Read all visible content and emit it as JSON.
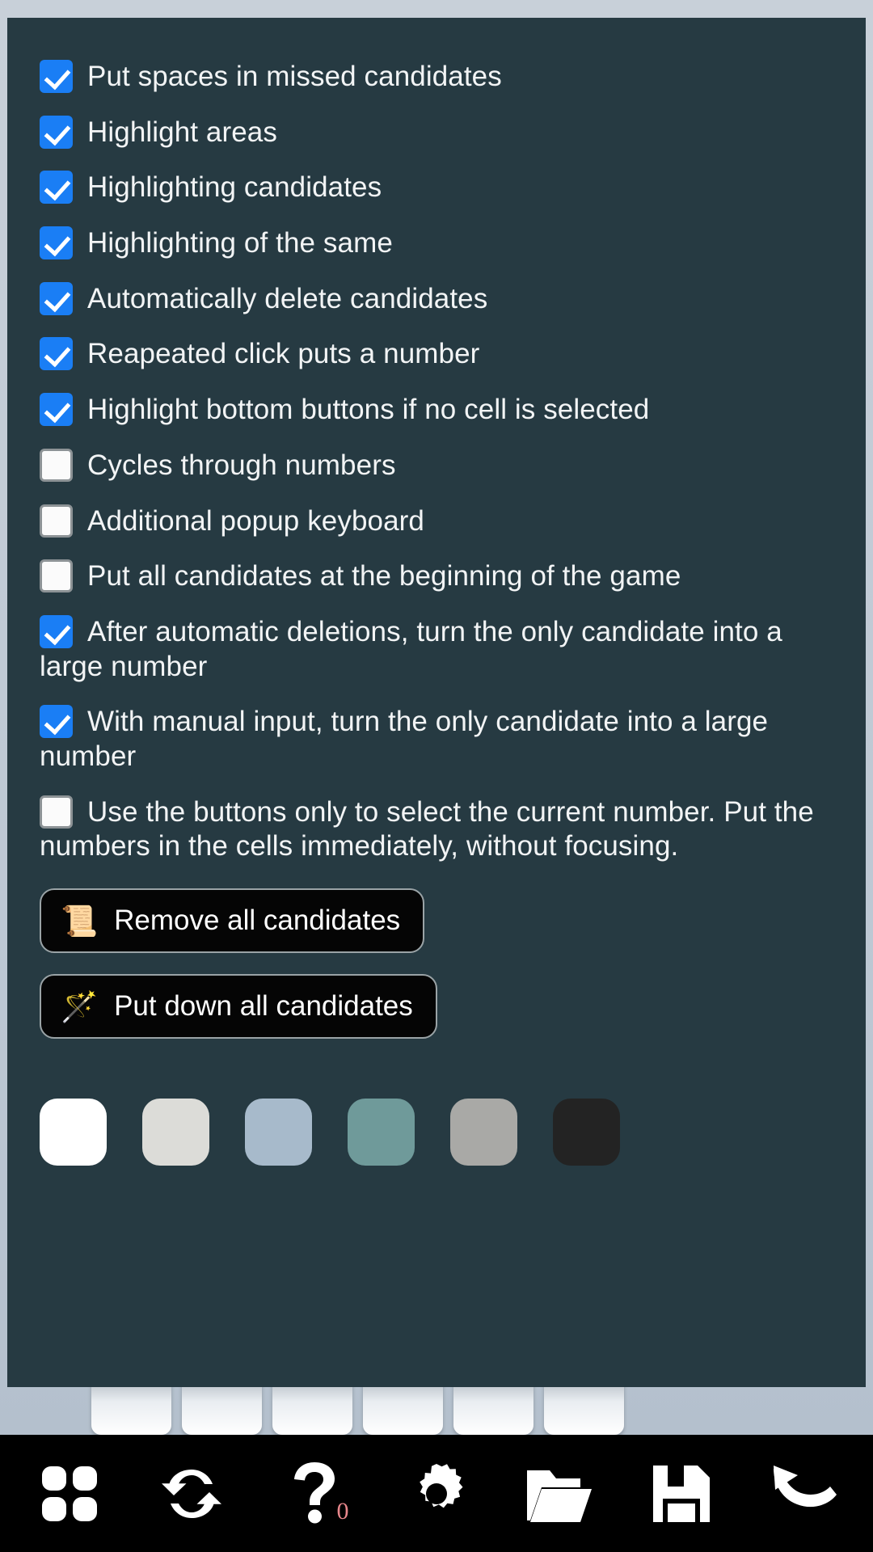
{
  "panel": {
    "background_color": "#263a42",
    "options": [
      {
        "label": "Put spaces in missed candidates",
        "checked": true
      },
      {
        "label": "Highlight areas",
        "checked": true
      },
      {
        "label": "Highlighting candidates",
        "checked": true
      },
      {
        "label": "Highlighting of the same",
        "checked": true
      },
      {
        "label": "Automatically delete candidates",
        "checked": true
      },
      {
        "label": "Reapeated click puts a number",
        "checked": true
      },
      {
        "label": "Highlight bottom buttons if no cell is selected",
        "checked": true
      },
      {
        "label": "Cycles through numbers",
        "checked": false
      },
      {
        "label": "Additional popup keyboard",
        "checked": false
      },
      {
        "label": "Put all candidates at the beginning of the game",
        "checked": false
      },
      {
        "label": "After automatic deletions, turn the only candidate into a large number",
        "checked": true
      },
      {
        "label": "With manual input, turn the only candidate into a large number",
        "checked": true
      },
      {
        "label": "Use the buttons only to select the current number. Put the numbers in the cells immediately, without focusing.",
        "checked": false
      }
    ],
    "actions": [
      {
        "icon": "scroll-icon",
        "glyph": "📜",
        "label": "Remove all candidates"
      },
      {
        "icon": "magic-wand-icon",
        "glyph": "🪄",
        "label": "Put down all candidates"
      }
    ],
    "theme_swatches": [
      {
        "name": "theme-white",
        "color": "#ffffff"
      },
      {
        "name": "theme-light-grey",
        "color": "#dcdcd8"
      },
      {
        "name": "theme-blue-grey",
        "color": "#a7bacb"
      },
      {
        "name": "theme-teal",
        "color": "#6f9a9a"
      },
      {
        "name": "theme-grey",
        "color": "#a9a9a6"
      },
      {
        "name": "theme-dark",
        "color": "#232323"
      }
    ]
  },
  "board": {
    "number_keys": [
      "",
      "",
      "",
      "",
      "",
      ""
    ]
  },
  "toolbar": {
    "buttons": [
      {
        "name": "grid-icon",
        "label": "Grid"
      },
      {
        "name": "refresh-icon",
        "label": "Restart"
      },
      {
        "name": "question-icon",
        "label": "Hint",
        "badge": "0"
      },
      {
        "name": "gear-icon",
        "label": "Settings"
      },
      {
        "name": "folder-open-icon",
        "label": "Open"
      },
      {
        "name": "floppy-disk-icon",
        "label": "Save"
      },
      {
        "name": "undo-icon",
        "label": "Undo"
      }
    ]
  }
}
